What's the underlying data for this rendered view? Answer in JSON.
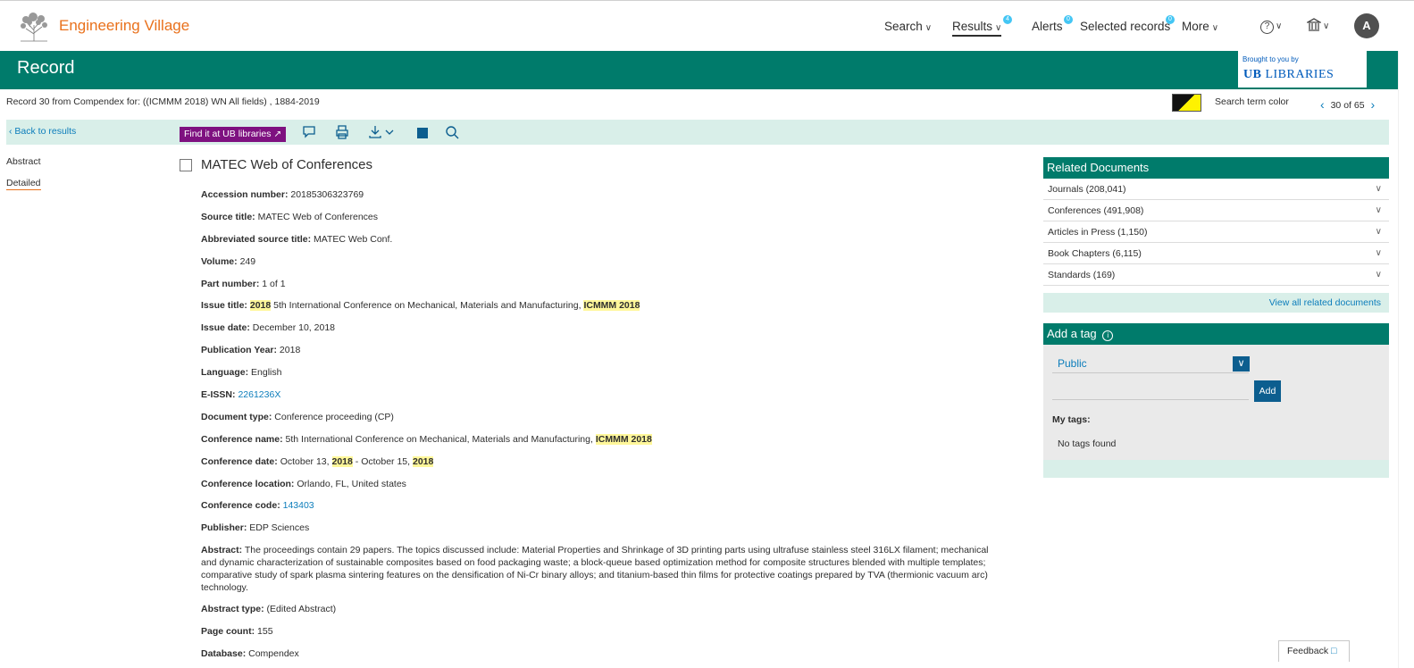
{
  "header": {
    "logo_text": "Engineering Village",
    "nav": {
      "search": "Search",
      "results": "Results",
      "results_badge": "4",
      "alerts": "Alerts",
      "alerts_badge": "0",
      "selected_records": "Selected records",
      "selected_badge": "0",
      "more": "More"
    },
    "avatar_initial": "A"
  },
  "band": {
    "title": "Record",
    "institution_brought": "Brought to you by",
    "institution_mark": "UB",
    "institution_name": "LIBRARIES"
  },
  "info": {
    "record_text": "Record 30 from Compendex for: ((ICMMM 2018) WN All fields) , 1884-2019",
    "search_term_color": "Search term color",
    "pager": "30 of 65"
  },
  "toolbar": {
    "back": "Back to results",
    "find_it": "Find it at UB libraries"
  },
  "left_nav": [
    "Abstract",
    "Detailed"
  ],
  "document": {
    "title": "MATEC Web of Conferences",
    "fields": [
      {
        "label": "Accession number:",
        "value": "20185306323769"
      },
      {
        "label": "Source title:",
        "value": "MATEC Web of Conferences"
      },
      {
        "label": "Abbreviated source title:",
        "value": "MATEC Web Conf."
      },
      {
        "label": "Volume:",
        "value": "249"
      },
      {
        "label": "Part number:",
        "value": "1 of 1"
      },
      {
        "label": "Issue title:",
        "hl1": "2018",
        "mid": "5th International Conference on Mechanical, Materials and Manufacturing,",
        "hl2": "ICMMM 2018"
      },
      {
        "label": "Issue date:",
        "value": "December 10, 2018"
      },
      {
        "label": "Publication Year:",
        "value": "2018"
      },
      {
        "label": "Language:",
        "value": "English"
      },
      {
        "label": "E-ISSN:",
        "link": "2261236X"
      },
      {
        "label": "Document type:",
        "value": "Conference proceeding (CP)"
      },
      {
        "label": "Conference name:",
        "mid": "5th International Conference on Mechanical, Materials and Manufacturing,",
        "hl2": "ICMMM 2018"
      },
      {
        "label": "Conference date:",
        "pre": "October 13,",
        "hl1": "2018",
        "mid": "- October 15,",
        "hl2": "2018"
      },
      {
        "label": "Conference location:",
        "value": "Orlando, FL, United states"
      },
      {
        "label": "Conference code:",
        "link": "143403"
      },
      {
        "label": "Publisher:",
        "value": "EDP Sciences"
      }
    ],
    "abstract_label": "Abstract:",
    "abstract_text": "The proceedings contain 29 papers. The topics discussed include: Material Properties and Shrinkage of 3D printing parts using ultrafuse stainless steel 316LX filament; mechanical and dynamic characterization of sustainable composites based on food packaging waste; a block-queue based optimization method for composite structures blended with multiple templates; comparative study of spark plasma sintering features on the densification of Ni-Cr binary alloys; and titanium-based thin films for protective coatings prepared by TVA (thermionic vacuum arc) technology.",
    "tail_fields": [
      {
        "label": "Abstract type:",
        "value": "(Edited Abstract)"
      },
      {
        "label": "Page count:",
        "value": "155"
      },
      {
        "label": "Database:",
        "value": "Compendex"
      }
    ]
  },
  "related": {
    "title": "Related Documents",
    "items": [
      "Journals (208,041)",
      "Conferences (491,908)",
      "Articles in Press (1,150)",
      "Book Chapters (6,115)",
      "Standards (169)"
    ],
    "view_all": "View all related documents"
  },
  "tags": {
    "title": "Add a tag",
    "visibility": "Public",
    "add_button": "Add",
    "my_tags": "My tags:",
    "none": "No tags found"
  },
  "feedback": "Feedback",
  "colors": {
    "brand_green": "#007b6b",
    "logo_orange": "#e9711c",
    "find_purple": "#7e1180",
    "highlight": "#fff79a",
    "link_blue": "#0c7dbb"
  }
}
